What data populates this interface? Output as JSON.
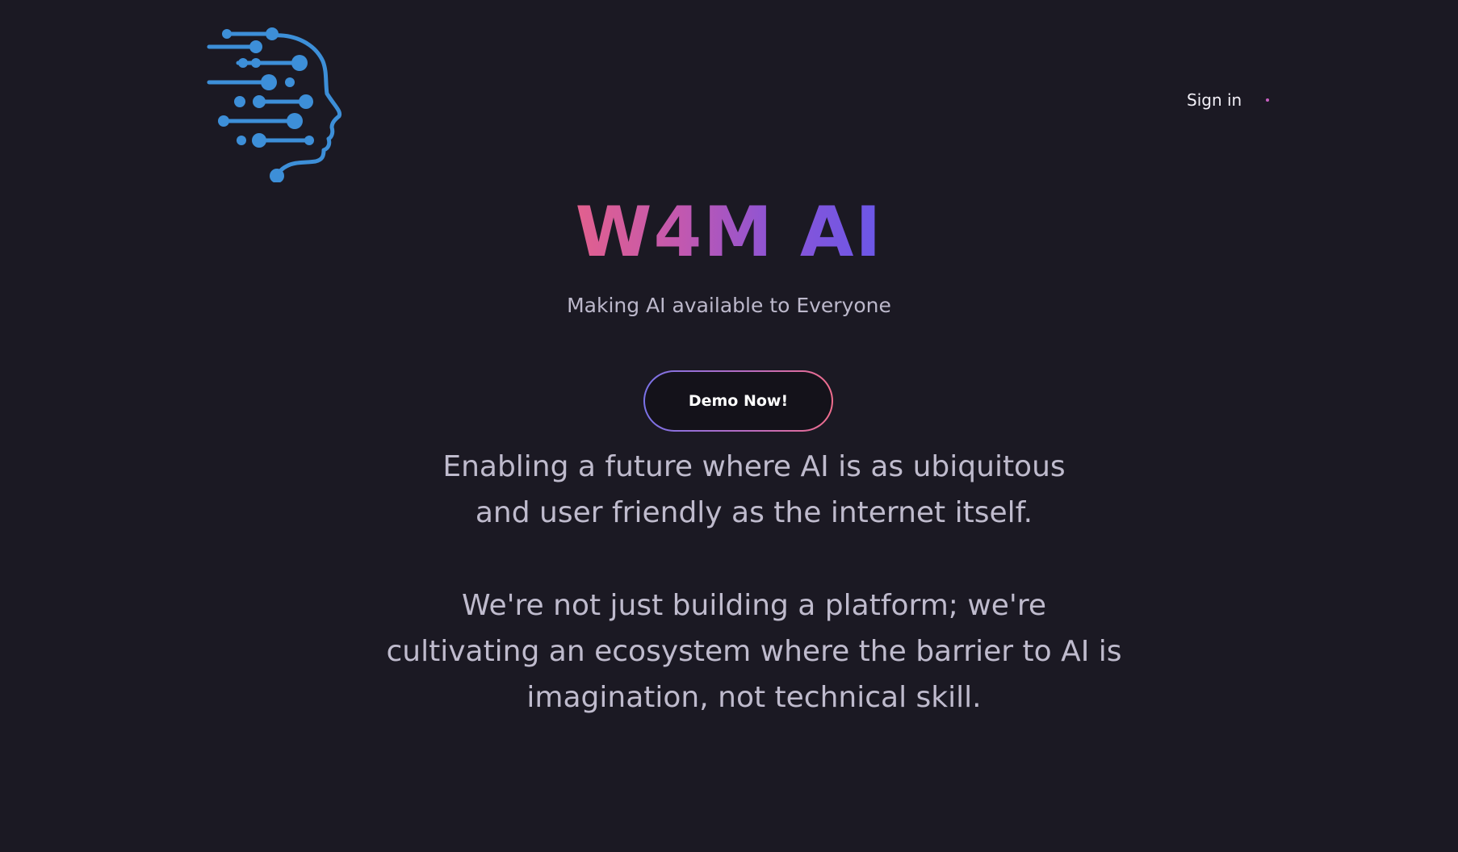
{
  "header": {
    "logo_icon": "ai-head-circuit-logo",
    "signin_label": "Sign in"
  },
  "hero": {
    "title": "W4M AI",
    "tagline": "Making AI available to Everyone",
    "cta_label": "Demo Now!"
  },
  "content": {
    "paragraph_1": "Enabling a future where AI is as ubiquitous and user friendly as the internet itself.",
    "paragraph_2": "We're not just building a platform; we're cultivating an ecosystem where the barrier to AI is imagination, not technical skill."
  },
  "colors": {
    "background": "#1b1923",
    "logo_blue": "#3d8fd8",
    "gradient_start": "#e2608e",
    "gradient_end": "#6a57e8"
  }
}
